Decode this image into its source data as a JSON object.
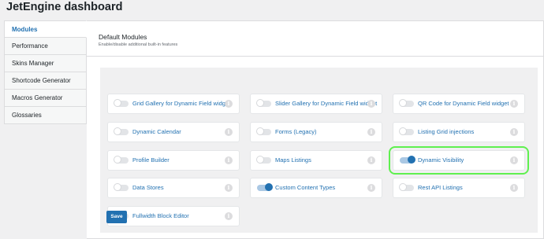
{
  "header": {
    "title": "JetEngine dashboard"
  },
  "sidebar": {
    "items": [
      {
        "label": "Modules"
      },
      {
        "label": "Performance"
      },
      {
        "label": "Skins Manager"
      },
      {
        "label": "Shortcode Generator"
      },
      {
        "label": "Macros Generator"
      },
      {
        "label": "Glossaries"
      }
    ]
  },
  "main": {
    "title": "Default Modules",
    "subtitle": "Enable/disable additional built-in features",
    "save_label": "Save",
    "info_icon": "i",
    "modules": [
      {
        "label": "Grid Gallery for Dynamic Field widget",
        "enabled": false
      },
      {
        "label": "Slider Gallery for Dynamic Field widget",
        "enabled": false
      },
      {
        "label": "QR Code for Dynamic Field widget",
        "enabled": false
      },
      {
        "label": "Dynamic Calendar",
        "enabled": false
      },
      {
        "label": "Forms (Legacy)",
        "enabled": false
      },
      {
        "label": "Listing Grid injections",
        "enabled": false
      },
      {
        "label": "Profile Builder",
        "enabled": false
      },
      {
        "label": "Maps Listings",
        "enabled": false
      },
      {
        "label": "Dynamic Visibility",
        "enabled": true
      },
      {
        "label": "Data Stores",
        "enabled": false
      },
      {
        "label": "Custom Content Types",
        "enabled": true
      },
      {
        "label": "Rest API Listings",
        "enabled": false
      },
      {
        "label": "Fullwidth Block Editor",
        "enabled": false
      }
    ]
  },
  "colors": {
    "accent": "#2271b1",
    "highlight": "#5ff04f"
  }
}
